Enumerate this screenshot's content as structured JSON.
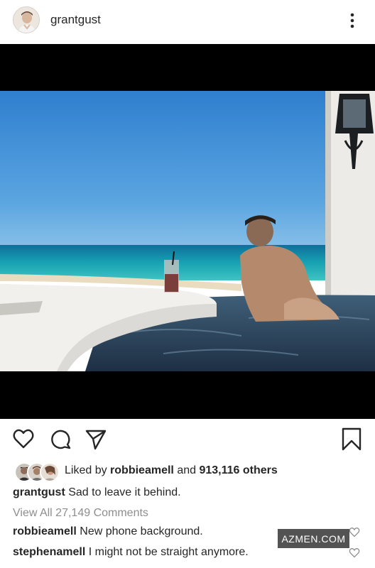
{
  "post": {
    "author": {
      "username": "grantgust"
    },
    "more_icon": "more-vertical-icon"
  },
  "actions": {
    "like_icon": "heart-icon",
    "comment_icon": "comment-icon",
    "share_icon": "paper-plane-icon",
    "save_icon": "bookmark-icon"
  },
  "likes": {
    "prefix": "Liked by",
    "user": "robbieamell",
    "joiner": "and",
    "others": "913,116 others"
  },
  "caption": {
    "username": "grantgust",
    "text": "Sad to leave it behind."
  },
  "view_all_comments": "View All 27,149 Comments",
  "comments": [
    {
      "username": "robbieamell",
      "text": "New phone background."
    },
    {
      "username": "stephenamell",
      "text": "I might not be straight anymore."
    }
  ],
  "watermark": "AZMEN.COM",
  "colors": {
    "text": "#262626",
    "muted": "#8e8e8e",
    "letterbox": "#000000",
    "sky": "#3f8fd8",
    "sea": "#1aa7b5"
  }
}
